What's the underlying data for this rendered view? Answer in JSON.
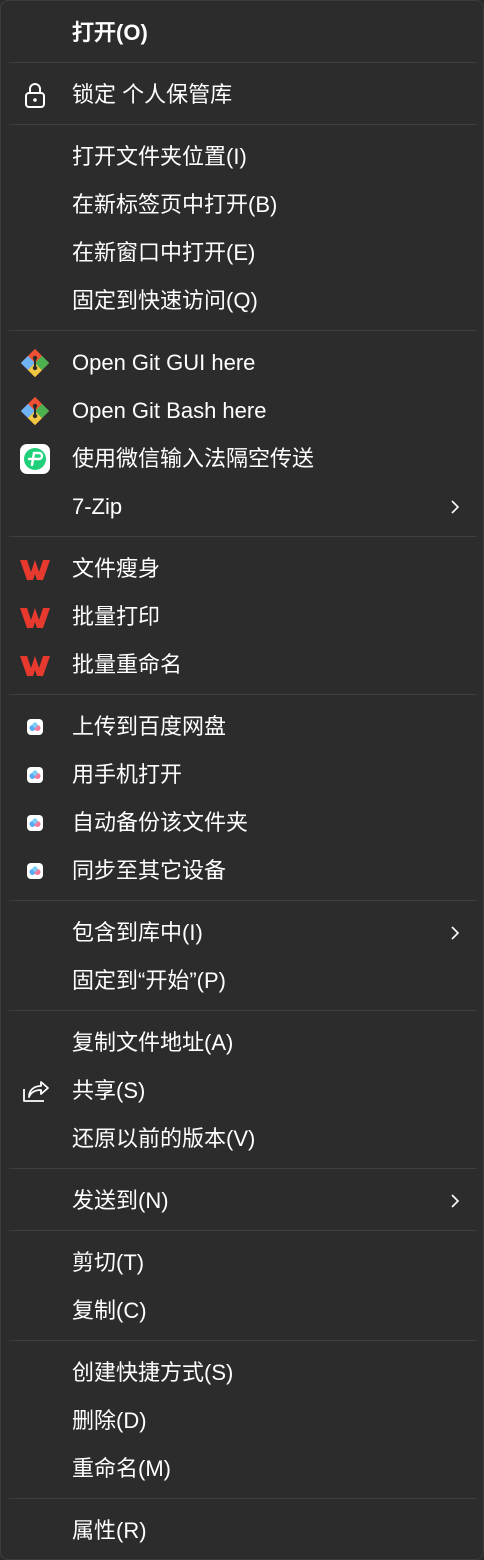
{
  "menu": {
    "open": "打开(O)",
    "lock_vault": "锁定 个人保管库",
    "open_folder_location": "打开文件夹位置(I)",
    "open_new_tab": "在新标签页中打开(B)",
    "open_new_window": "在新窗口中打开(E)",
    "pin_quick_access": "固定到快速访问(Q)",
    "git_gui": "Open Git GUI here",
    "git_bash": "Open Git Bash here",
    "wechat_ime_transfer": "使用微信输入法隔空传送",
    "seven_zip": "7-Zip",
    "file_slim": "文件瘦身",
    "batch_print": "批量打印",
    "batch_rename": "批量重命名",
    "upload_baidu": "上传到百度网盘",
    "open_phone": "用手机打开",
    "auto_backup": "自动备份该文件夹",
    "sync_devices": "同步至其它设备",
    "include_library": "包含到库中(I)",
    "pin_start": "固定到“开始”(P)",
    "copy_path": "复制文件地址(A)",
    "share": "共享(S)",
    "restore_versions": "还原以前的版本(V)",
    "send_to": "发送到(N)",
    "cut": "剪切(T)",
    "copy": "复制(C)",
    "create_shortcut": "创建快捷方式(S)",
    "delete": "删除(D)",
    "rename": "重命名(M)",
    "properties": "属性(R)"
  },
  "icons": {
    "lock": "lock-icon",
    "git": "git-icon",
    "wechat_ime": "wechat-ime-icon",
    "wps": "wps-icon",
    "baidu": "baidu-netdisk-icon",
    "share": "share-icon",
    "chevron": "chevron-right-icon"
  },
  "colors": {
    "background": "#2c2c2c",
    "text": "#ffffff",
    "separator": "#3e3e3e",
    "wps_red": "#e8392e",
    "wechat_green": "#1fcf7a",
    "git_orange": "#f05133"
  }
}
